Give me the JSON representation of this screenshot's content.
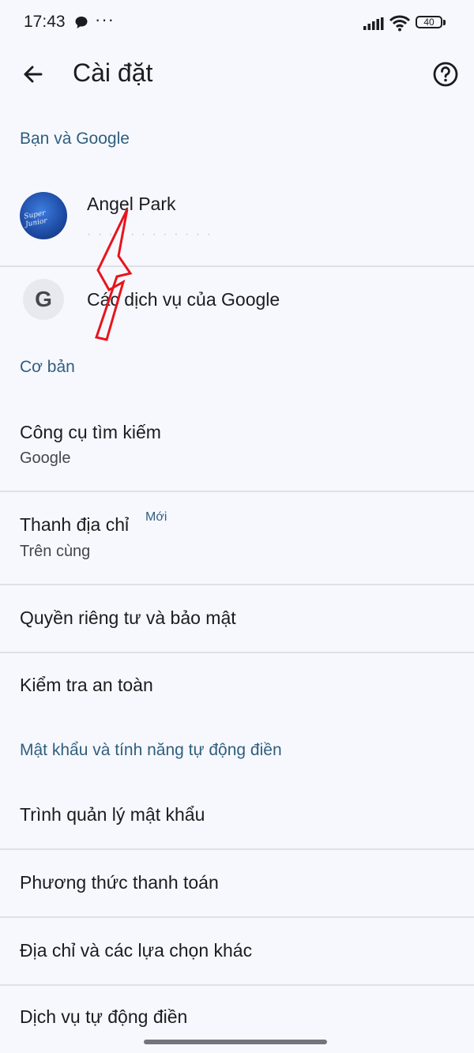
{
  "status_bar": {
    "time": "17:43",
    "more": "···",
    "battery": "40"
  },
  "app_bar": {
    "title": "Cài đặt"
  },
  "sections": {
    "you_google": "Bạn và Google",
    "basics": "Cơ bản",
    "passwords": "Mật khẩu và tính năng tự động điền"
  },
  "account": {
    "name": "Angel Park",
    "email": "· · · · · · · · · · · ·",
    "avatar_text": "Super Junior"
  },
  "google_services": {
    "label": "Các dịch vụ của Google",
    "icon_letter": "G"
  },
  "items": {
    "search_engine": {
      "title": "Công cụ tìm kiếm",
      "sub": "Google"
    },
    "address_bar": {
      "title": "Thanh địa chỉ",
      "badge": "Mới",
      "sub": "Trên cùng"
    },
    "privacy": {
      "title": "Quyền riêng tư và bảo mật"
    },
    "safety_check": {
      "title": "Kiểm tra an toàn"
    },
    "password_manager": {
      "title": "Trình quản lý mật khẩu"
    },
    "payment": {
      "title": "Phương thức thanh toán"
    },
    "addresses": {
      "title": "Địa chỉ và các lựa chọn khác"
    },
    "autofill": {
      "title": "Dịch vụ tự động điền"
    }
  },
  "colors": {
    "accent": "#2f5f7e",
    "background": "#f7f8fe",
    "annotation": "#e8141c"
  }
}
